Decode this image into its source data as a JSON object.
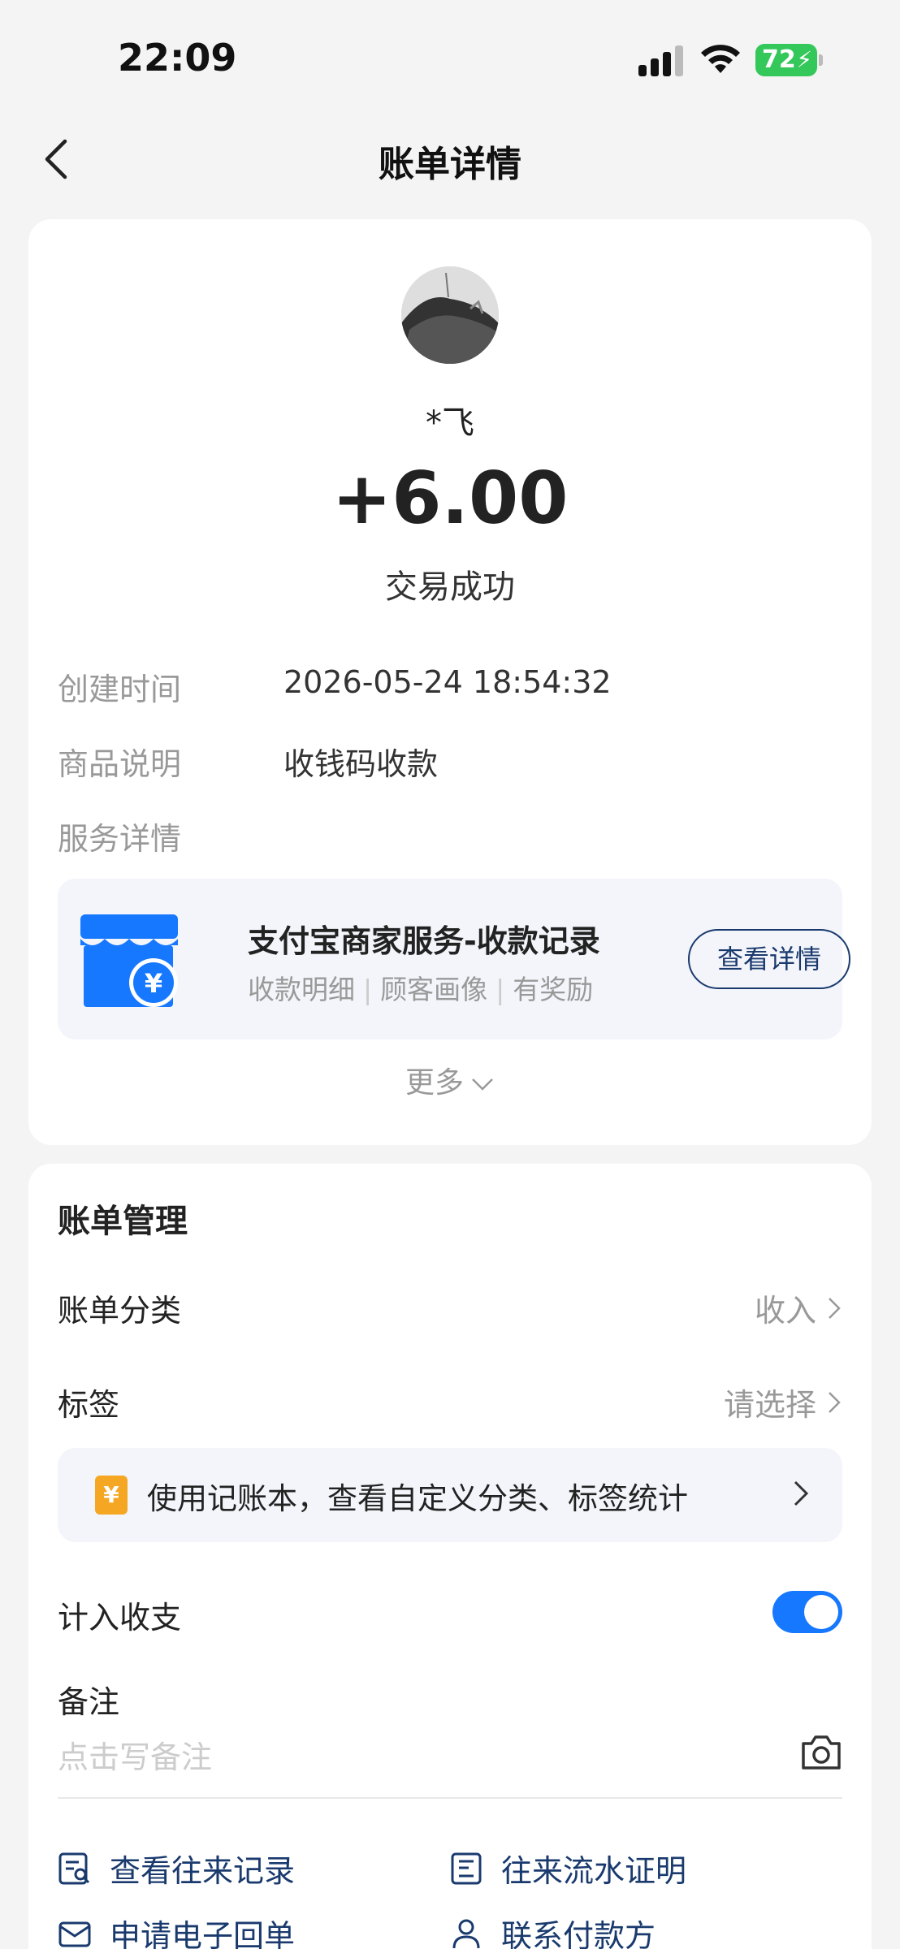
{
  "status_bar": {
    "time": "22:09",
    "battery": "72"
  },
  "nav": {
    "title": "账单详情"
  },
  "transaction": {
    "payer_name": "*飞",
    "amount": "+6.00",
    "status": "交易成功"
  },
  "info": [
    {
      "label": "创建时间",
      "value": "2026-05-24 18:54:32"
    },
    {
      "label": "商品说明",
      "value": "收钱码收款"
    },
    {
      "label": "服务详情",
      "value": ""
    }
  ],
  "service_card": {
    "title": "支付宝商家服务-收款记录",
    "tags": [
      "收款明细",
      "顾客画像",
      "有奖励"
    ],
    "button_label": "查看详情",
    "icon_symbol": "¥"
  },
  "more_label": "更多",
  "bill_management": {
    "title": "账单管理",
    "category": {
      "label": "账单分类",
      "value": "收入"
    },
    "tag": {
      "label": "标签",
      "value": "请选择"
    },
    "promo": {
      "icon_symbol": "¥",
      "text": "使用记账本，查看自定义分类、标签统计"
    },
    "include_in_stats": {
      "label": "计入收支",
      "enabled": true
    },
    "memo": {
      "label": "备注",
      "placeholder": "点击写备注"
    }
  },
  "links": [
    {
      "label": "查看往来记录",
      "icon": "record-search-icon"
    },
    {
      "label": "往来流水证明",
      "icon": "document-icon"
    },
    {
      "label": "申请电子回单",
      "icon": "mail-icon"
    },
    {
      "label": "联系付款方",
      "icon": "person-icon"
    }
  ],
  "colors": {
    "accent": "#1677ff",
    "link": "#1a3a6e",
    "battery": "#34c759",
    "promo_icon": "#f5a623",
    "store_blue": "#1677ff"
  }
}
